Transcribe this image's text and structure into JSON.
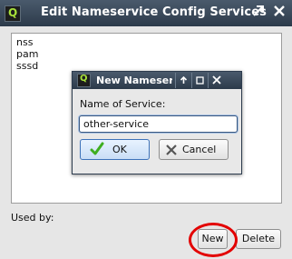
{
  "window": {
    "title": "Edit Nameservice Config Services",
    "app_icon_letter": "Q",
    "app_icon_color": "#a8e23a"
  },
  "services": [
    "nss",
    "pam",
    "sssd"
  ],
  "used_by_label": "Used by:",
  "buttons": {
    "new_label": "New",
    "delete_label": "Delete"
  },
  "annotation": {
    "color": "#e30000"
  },
  "dialog": {
    "title": "New Nameservice",
    "app_icon_letter": "Q",
    "prompt_label": "Name of Service:",
    "input_value": "other-service",
    "ok_label": "OK",
    "cancel_label": "Cancel"
  }
}
